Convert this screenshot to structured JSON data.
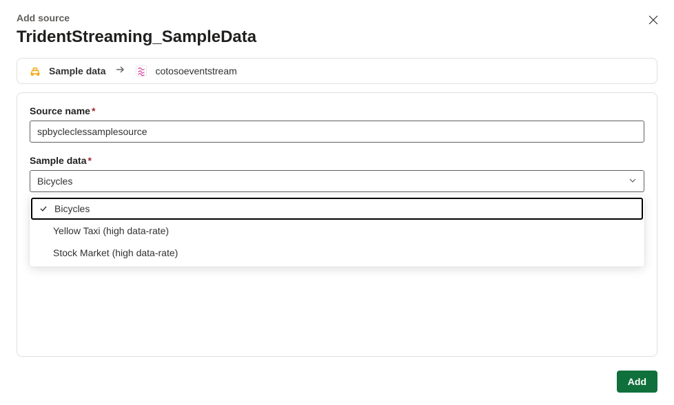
{
  "header": {
    "subtitle": "Add source",
    "title": "TridentStreaming_SampleData"
  },
  "breadcrumb": {
    "source_label": "Sample data",
    "destination_label": "cotosoeventstream"
  },
  "form": {
    "source_name": {
      "label": "Source name",
      "value": "spbycleclessamplesource"
    },
    "sample_data": {
      "label": "Sample data",
      "selected": "Bicycles",
      "options": [
        {
          "label": "Bicycles",
          "selected": true
        },
        {
          "label": "Yellow Taxi (high data-rate)",
          "selected": false
        },
        {
          "label": "Stock Market (high data-rate)",
          "selected": false
        }
      ]
    }
  },
  "footer": {
    "add_label": "Add"
  }
}
